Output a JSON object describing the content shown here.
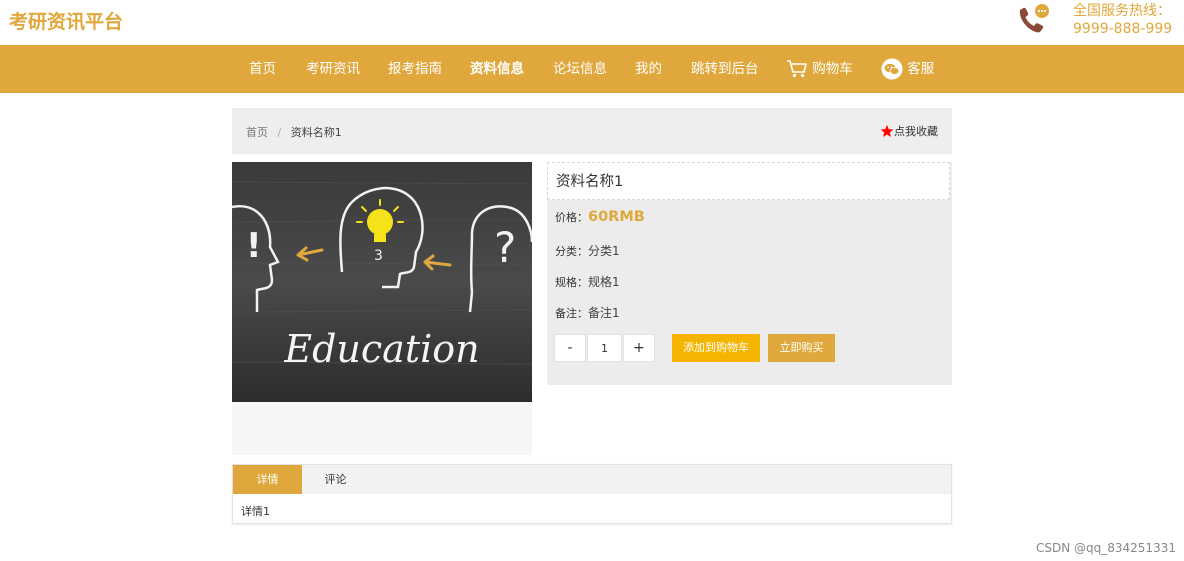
{
  "header": {
    "site_title": "考研资讯平台",
    "hotline_label": "全国服务热线：",
    "hotline_number": "9999-888-999"
  },
  "nav": {
    "items": [
      {
        "label": "首页"
      },
      {
        "label": "考研资讯"
      },
      {
        "label": "报考指南"
      },
      {
        "label": "资料信息",
        "active": true
      },
      {
        "label": "论坛信息"
      },
      {
        "label": "我的"
      },
      {
        "label": "跳转到后台"
      },
      {
        "label": "购物车",
        "icon": "cart-icon"
      },
      {
        "label": "客服",
        "icon": "chat-icon"
      }
    ]
  },
  "breadcrumb": {
    "home": "首页",
    "separator": "/",
    "current": "资料名称1"
  },
  "favorite": {
    "label": "点我收藏",
    "icon": "star-icon",
    "icon_color": "#ff0000"
  },
  "product": {
    "image_text": "Education",
    "title": "资料名称1",
    "price_label": "价格：",
    "price_value": "60RMB",
    "category_label": "分类：",
    "category_value": "分类1",
    "spec_label": "规格：",
    "spec_value": "规格1",
    "remark_label": "备注：",
    "remark_value": "备注1",
    "quantity": "1",
    "minus_label": "-",
    "plus_label": "+",
    "add_to_cart_label": "添加到购物车",
    "buy_now_label": "立即购买"
  },
  "tabs": {
    "items": [
      {
        "label": "详情",
        "active": true
      },
      {
        "label": "评论"
      }
    ],
    "content": "详情1"
  },
  "watermark": "CSDN @qq_834251331",
  "colors": {
    "accent": "#e0a83c",
    "cart_button": "#f5b400",
    "panel_bg": "#ececec"
  }
}
